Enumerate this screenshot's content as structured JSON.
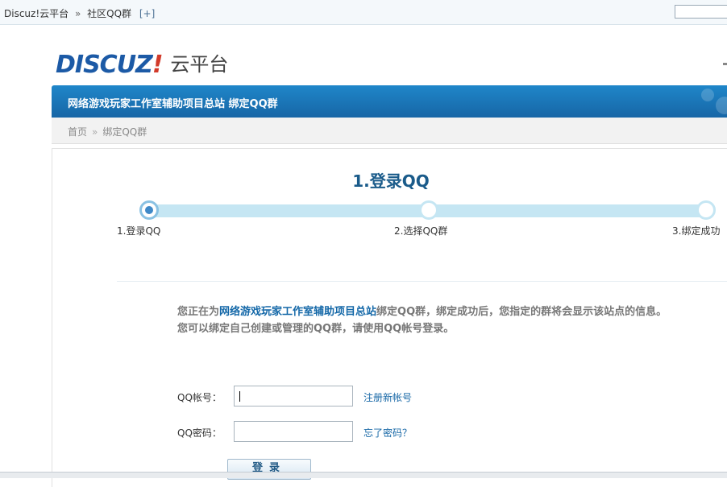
{
  "topbar": {
    "site": "Discuz!云平台",
    "separator": "»",
    "section": "社区QQ群",
    "expand": "[+]"
  },
  "logo": {
    "brand": "DISCUZ",
    "bang": "!",
    "product": "云平台"
  },
  "header": {
    "title": "网络游戏玩家工作室辅助项目总站 绑定QQ群"
  },
  "breadcrumb": {
    "home": "首页",
    "arrow": "»",
    "current": "绑定QQ群"
  },
  "steps": {
    "current_title": "1.登录QQ",
    "items": [
      {
        "label": "1.登录QQ",
        "active": true
      },
      {
        "label": "2.选择QQ群",
        "active": false
      },
      {
        "label": "3.绑定成功",
        "active": false
      }
    ]
  },
  "info": {
    "prefix": "您正在为",
    "site": "网络游戏玩家工作室辅助项目总站",
    "suffix": "绑定QQ群，绑定成功后，您指定的群将会显示该站点的信息。",
    "line2": "您可以绑定自己创建或管理的QQ群，请使用QQ帐号登录。"
  },
  "form": {
    "account_label": "QQ帐号：",
    "account_value": "",
    "register_link": "注册新帐号",
    "password_label": "QQ密码：",
    "password_value": "",
    "forgot_link": "忘了密码？",
    "login_button": "登录"
  },
  "colors": {
    "header_blue": "#1b76b8",
    "step_track": "#c5e6f3",
    "link_blue": "#1667a6"
  }
}
